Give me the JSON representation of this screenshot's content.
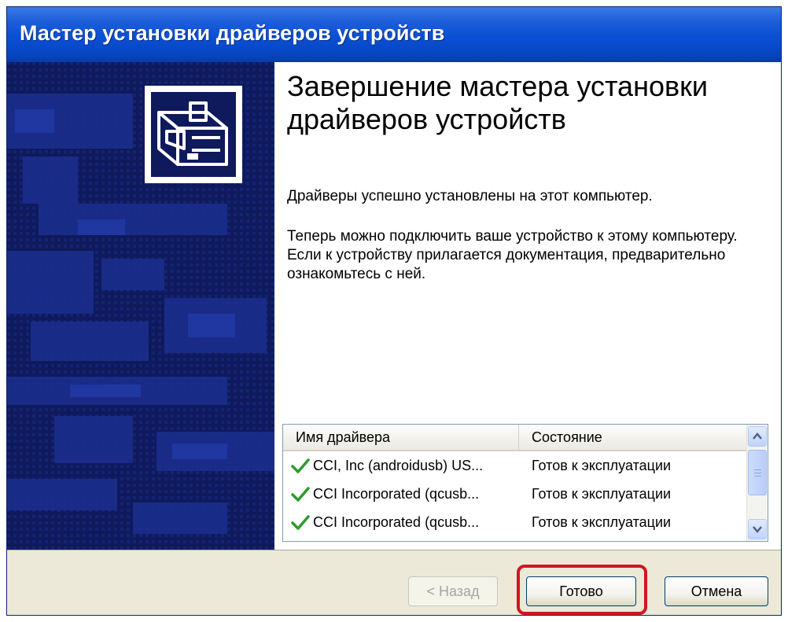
{
  "window": {
    "title": "Мастер установки драйверов устройств"
  },
  "wizard": {
    "heading": "Завершение мастера установки драйверов устройств",
    "success_text": "Драйверы успешно установлены на этот компьютер.",
    "info_text": "Теперь можно подключить ваше устройство к этому компьютеру. Если к устройству прилагается документация, предварительно ознакомьтесь с ней.",
    "side_icon": "hardware-drawer-icon"
  },
  "driver_list": {
    "columns": [
      "Имя драйвера",
      "Состояние"
    ],
    "rows": [
      {
        "name": "CCI, Inc (androidusb) US...",
        "status": "Готов к эксплуатации",
        "icon": "checkmark-icon"
      },
      {
        "name": "CCI Incorporated (qcusb...",
        "status": "Готов к эксплуатации",
        "icon": "checkmark-icon"
      },
      {
        "name": "CCI Incorporated (qcusb...",
        "status": "Готов к эксплуатации",
        "icon": "checkmark-icon"
      }
    ]
  },
  "buttons": {
    "back": "< Назад",
    "finish": "Готово",
    "cancel": "Отмена"
  },
  "colors": {
    "titlebar": "#0a4fd3",
    "side_panel": "#0f1a5c",
    "check": "#2e9b2e",
    "highlight": "#d2161e",
    "dialog_face": "#ece9d8"
  }
}
